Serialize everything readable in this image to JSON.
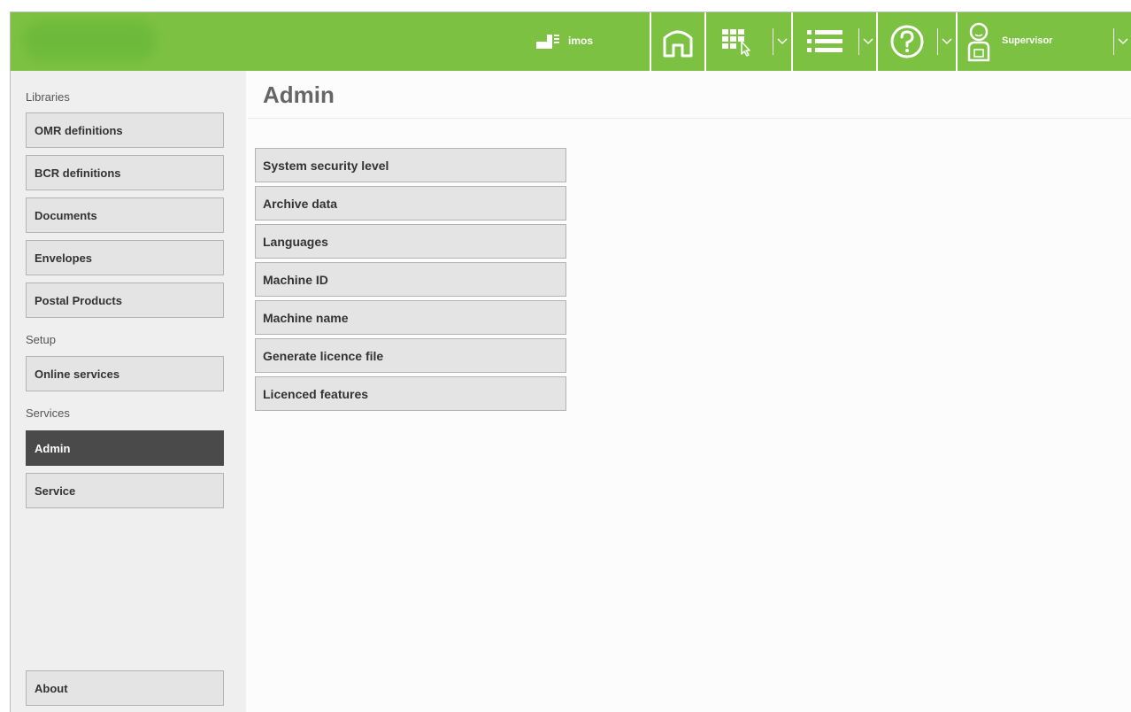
{
  "header": {
    "imos_label": "imos",
    "user_label": "Supervisor",
    "icons": [
      "imos-icon",
      "home-icon",
      "apps-icon",
      "list-icon",
      "help-icon",
      "user-icon",
      "chevron-down-icon"
    ],
    "accent_color": "#7cc142"
  },
  "sidebar": {
    "sections": [
      {
        "label": "Libraries",
        "items": [
          {
            "label": "OMR definitions"
          },
          {
            "label": "BCR definitions"
          },
          {
            "label": "Documents"
          },
          {
            "label": "Envelopes"
          },
          {
            "label": "Postal Products"
          }
        ]
      },
      {
        "label": "Setup",
        "items": [
          {
            "label": "Online services"
          }
        ]
      },
      {
        "label": "Services",
        "items": [
          {
            "label": "Admin",
            "active": true
          },
          {
            "label": "Service"
          }
        ]
      }
    ],
    "about_label": "About"
  },
  "main": {
    "title": "Admin",
    "items": [
      {
        "label": "System security level"
      },
      {
        "label": "Archive data"
      },
      {
        "label": "Languages"
      },
      {
        "label": "Machine ID"
      },
      {
        "label": "Machine name"
      },
      {
        "label": "Generate licence file"
      },
      {
        "label": "Licenced features"
      }
    ]
  }
}
